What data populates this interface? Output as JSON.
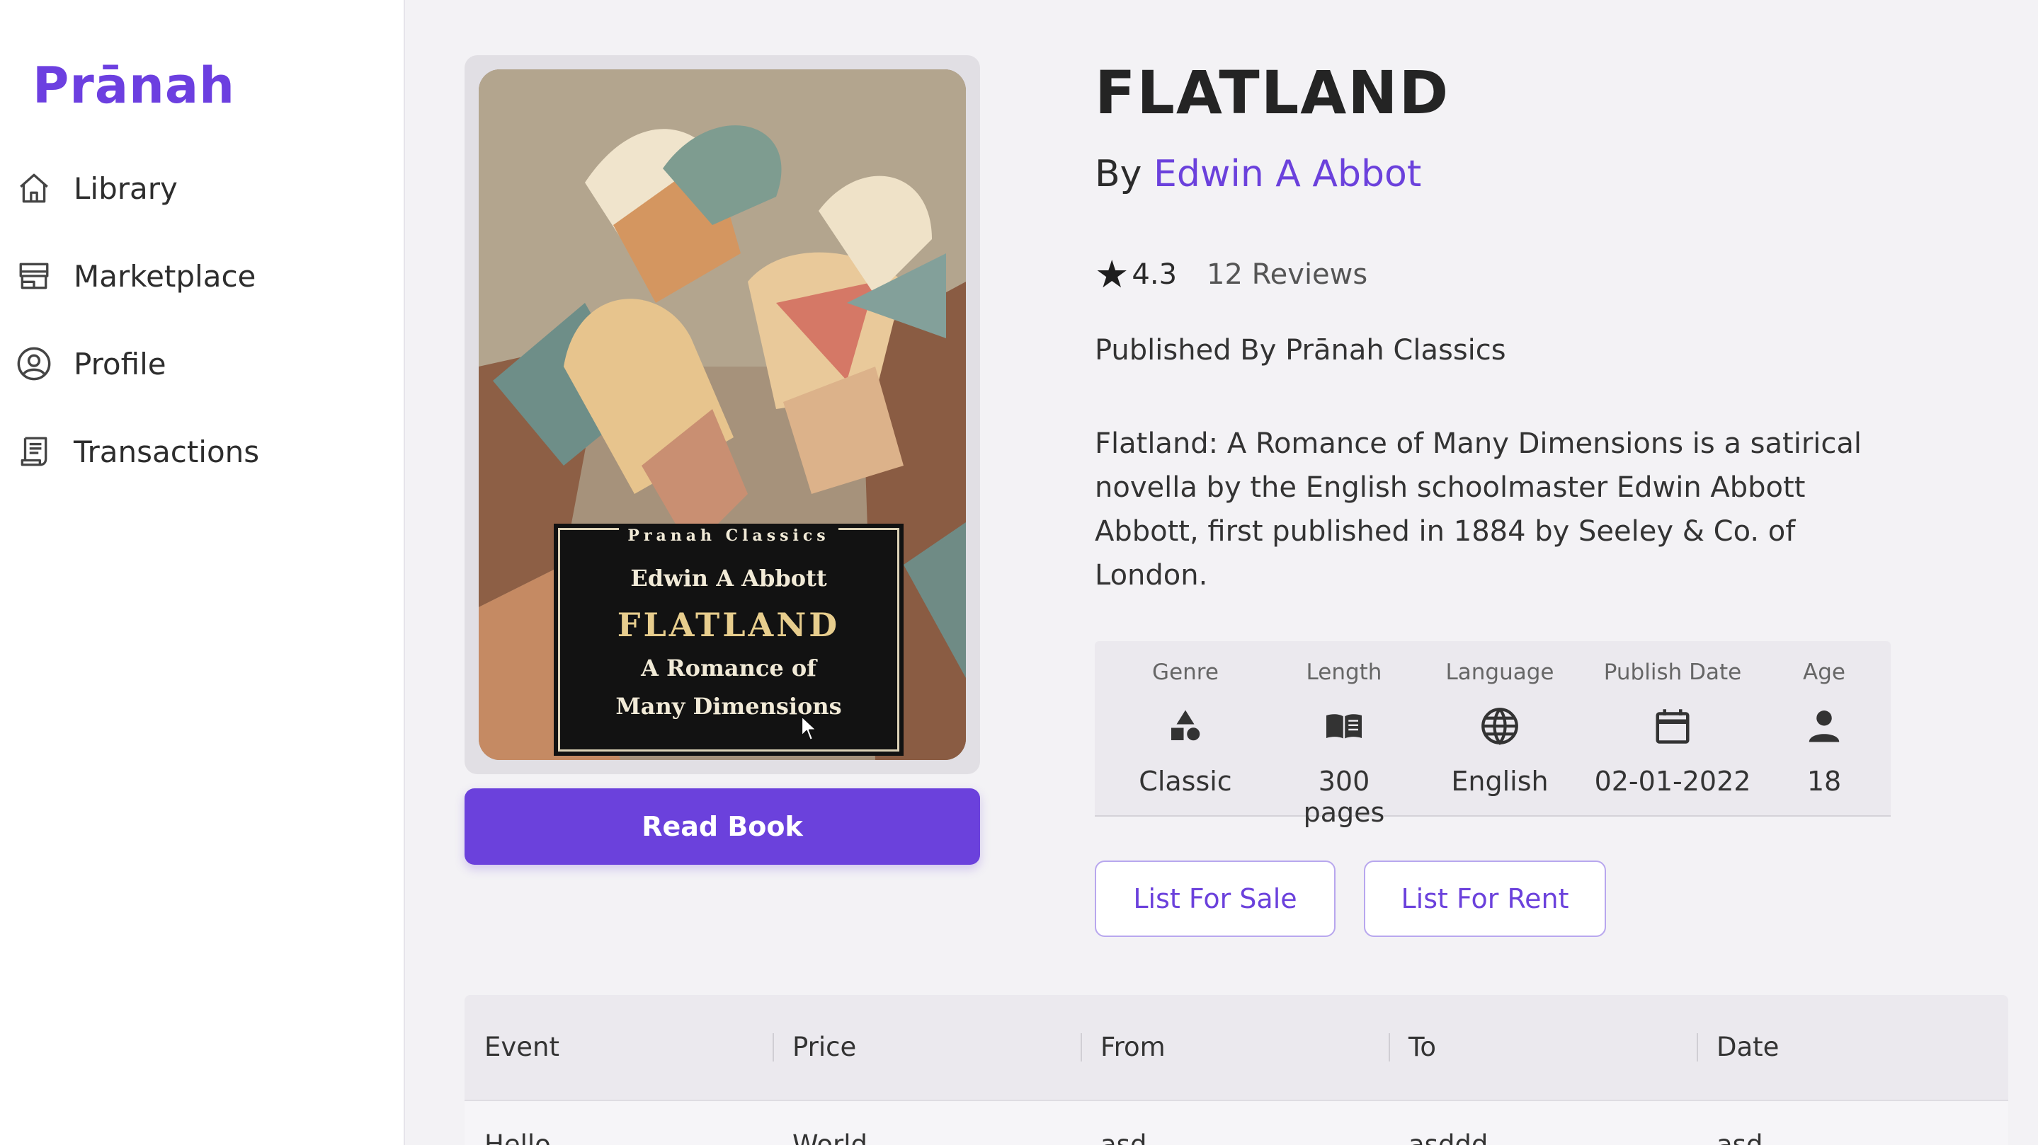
{
  "app": {
    "logo": "Prānah"
  },
  "sidebar": {
    "items": [
      {
        "label": "Library",
        "icon": "home-icon"
      },
      {
        "label": "Marketplace",
        "icon": "store-icon"
      },
      {
        "label": "Profile",
        "icon": "user-circle-icon"
      },
      {
        "label": "Transactions",
        "icon": "receipt-icon"
      }
    ]
  },
  "cover": {
    "series": "Pranah Classics",
    "author": "Edwin A Abbott",
    "title": "FLATLAND",
    "subtitle_line1": "A Romance of",
    "subtitle_line2": "Many Dimensions"
  },
  "read_button": "Read Book",
  "book": {
    "title": "FLATLAND",
    "by_prefix": "By",
    "author": "Edwin A Abbot",
    "rating": "4.3",
    "reviews": "12 Reviews",
    "publisher": "Published By Prānah Classics",
    "description": "Flatland: A Romance of Many Dimensions is a satirical novella by the English schoolmaster Edwin Abbott Abbott, first published in 1884 by Seeley & Co. of London."
  },
  "meta": {
    "genre": {
      "label": "Genre",
      "value": "Classic",
      "icon": "shapes-icon"
    },
    "length": {
      "label": "Length",
      "value": "300 pages",
      "icon": "book-icon"
    },
    "language": {
      "label": "Language",
      "value": "English",
      "icon": "globe-icon"
    },
    "publish_date": {
      "label": "Publish Date",
      "value": "02-01-2022",
      "icon": "calendar-icon"
    },
    "age": {
      "label": "Age",
      "value": "18",
      "icon": "person-icon"
    }
  },
  "actions": {
    "list_for_sale": "List For Sale",
    "list_for_rent": "List For Rent"
  },
  "table": {
    "columns": [
      "Event",
      "Price",
      "From",
      "To",
      "Date"
    ],
    "rows": [
      [
        "Hello",
        "World",
        "asd",
        "asddd",
        "asd"
      ]
    ]
  },
  "colors": {
    "accent": "#6b41dc",
    "background": "#f3f2f5"
  }
}
